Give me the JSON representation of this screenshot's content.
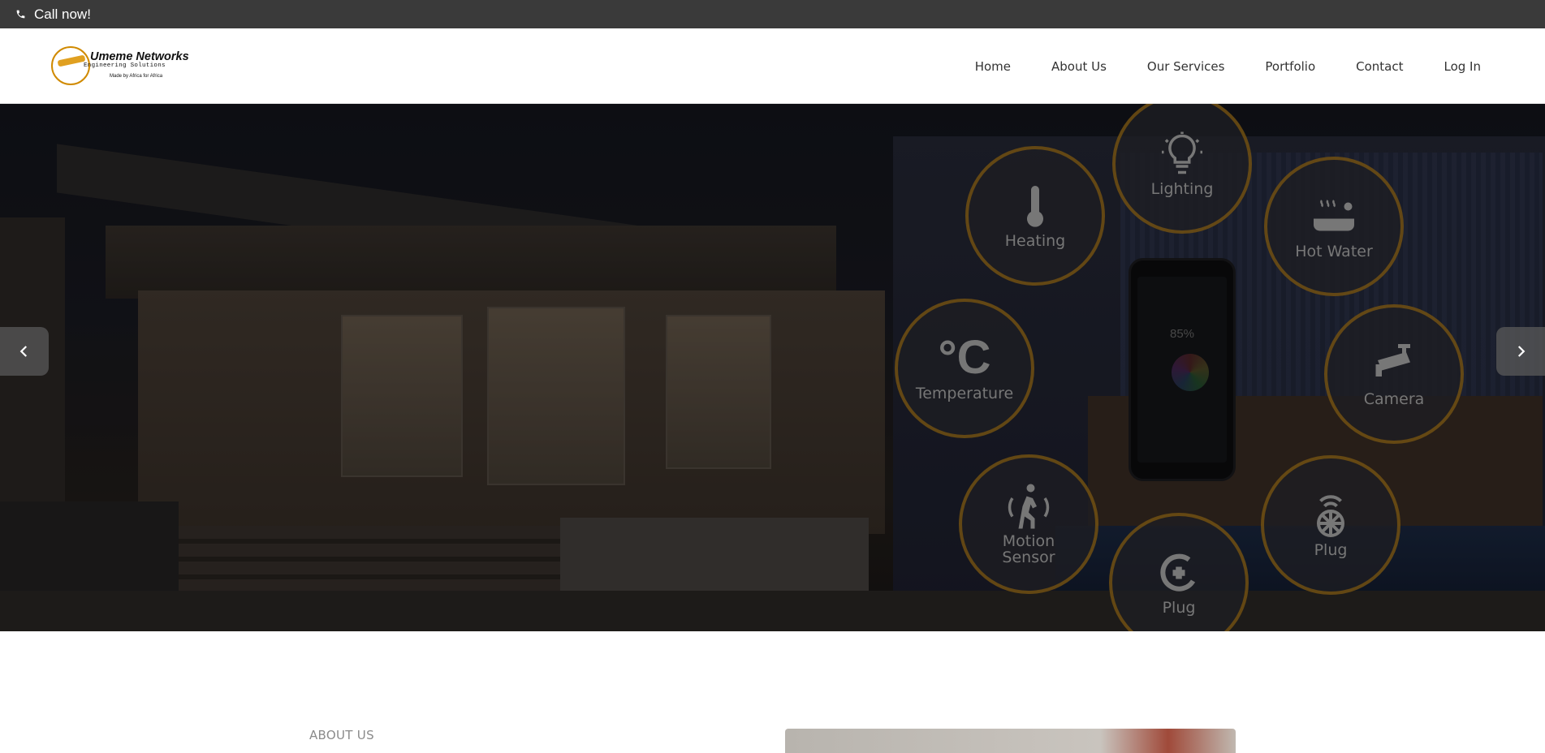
{
  "topbar": {
    "call_label": "Call now!"
  },
  "logo": {
    "brand": "Umeme Networks",
    "tagline": "Engineering Solutions",
    "motto": "Made by Africa for Africa"
  },
  "nav": {
    "items": [
      "Home",
      "About Us",
      "Our Services",
      "Portfolio",
      "Contact",
      "Log In"
    ]
  },
  "hero": {
    "phone_percent": "85%",
    "features": [
      {
        "label": "Lighting",
        "icon": "lightbulb-icon"
      },
      {
        "label": "Heating",
        "icon": "thermometer-icon"
      },
      {
        "label": "Hot Water",
        "icon": "hot-tub-icon"
      },
      {
        "label": "Temperature",
        "icon": "celsius-icon"
      },
      {
        "label": "Camera",
        "icon": "security-camera-icon"
      },
      {
        "label": "Motion Sensor",
        "icon": "walking-person-icon"
      },
      {
        "label": "Plug",
        "icon": "plug-icon"
      },
      {
        "label": "Plug",
        "icon": "smart-plug-icon"
      }
    ],
    "accent": "#d08a00"
  },
  "about": {
    "label": "ABOUT US"
  }
}
